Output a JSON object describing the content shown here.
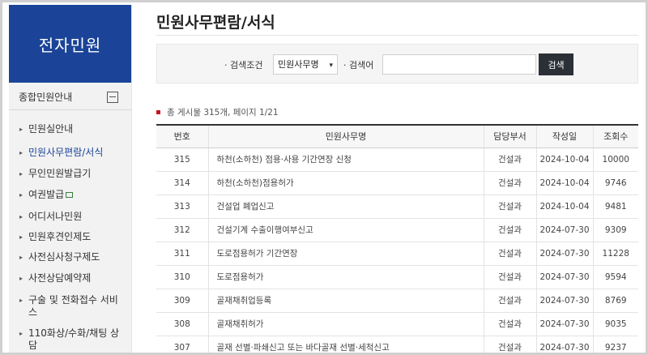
{
  "sidebar": {
    "title": "전자민원",
    "section_label": "종합민원안내",
    "items": [
      {
        "label": "민원실안내",
        "active": false,
        "icon": null
      },
      {
        "label": "민원사무편람/서식",
        "active": true,
        "icon": null
      },
      {
        "label": "무인민원발급기",
        "active": false,
        "icon": null
      },
      {
        "label": "여권발급",
        "active": false,
        "icon": "lock-icon"
      },
      {
        "label": "어디서나민원",
        "active": false,
        "icon": null
      },
      {
        "label": "민원후견인제도",
        "active": false,
        "icon": null
      },
      {
        "label": "사전심사청구제도",
        "active": false,
        "icon": null
      },
      {
        "label": "사전상담예약제",
        "active": false,
        "icon": null
      },
      {
        "label": "구술 및 전화접수 서비스",
        "active": false,
        "icon": null
      },
      {
        "label": "110화상/수화/채팅 상담",
        "active": false,
        "icon": null
      }
    ]
  },
  "main": {
    "page_title": "민원사무편람/서식",
    "search": {
      "condition_label": "· 검색조건",
      "condition_value": "민원사무명",
      "keyword_label": "· 검색어",
      "keyword_value": "",
      "button_label": "검색"
    },
    "summary": "총 게시물 315개, 페이지 1/21",
    "table": {
      "headers": [
        "번호",
        "민원사무명",
        "담당부서",
        "작성일",
        "조회수"
      ],
      "rows": [
        [
          "315",
          "하천(소하천) 점용·사용 기간연장 신청",
          "건설과",
          "2024-10-04",
          "10000"
        ],
        [
          "314",
          "하천(소하천)점용허가",
          "건설과",
          "2024-10-04",
          "9746"
        ],
        [
          "313",
          "건설업 폐업신고",
          "건설과",
          "2024-10-04",
          "9481"
        ],
        [
          "312",
          "건설기계 수출이행여부신고",
          "건설과",
          "2024-07-30",
          "9309"
        ],
        [
          "311",
          "도로점용허가 기간연장",
          "건설과",
          "2024-07-30",
          "11228"
        ],
        [
          "310",
          "도로점용허가",
          "건설과",
          "2024-07-30",
          "9594"
        ],
        [
          "309",
          "골재채취업등록",
          "건설과",
          "2024-07-30",
          "8769"
        ],
        [
          "308",
          "골재채취허가",
          "건설과",
          "2024-07-30",
          "9035"
        ],
        [
          "307",
          "골재 선별·파쇄신고 또는 바다골재 선별·세척신고",
          "건설과",
          "2024-07-30",
          "9237"
        ]
      ]
    }
  },
  "colors": {
    "brand_blue": "#1b4498",
    "button_dark": "#2b2f36",
    "accent_red": "#c8161d"
  }
}
